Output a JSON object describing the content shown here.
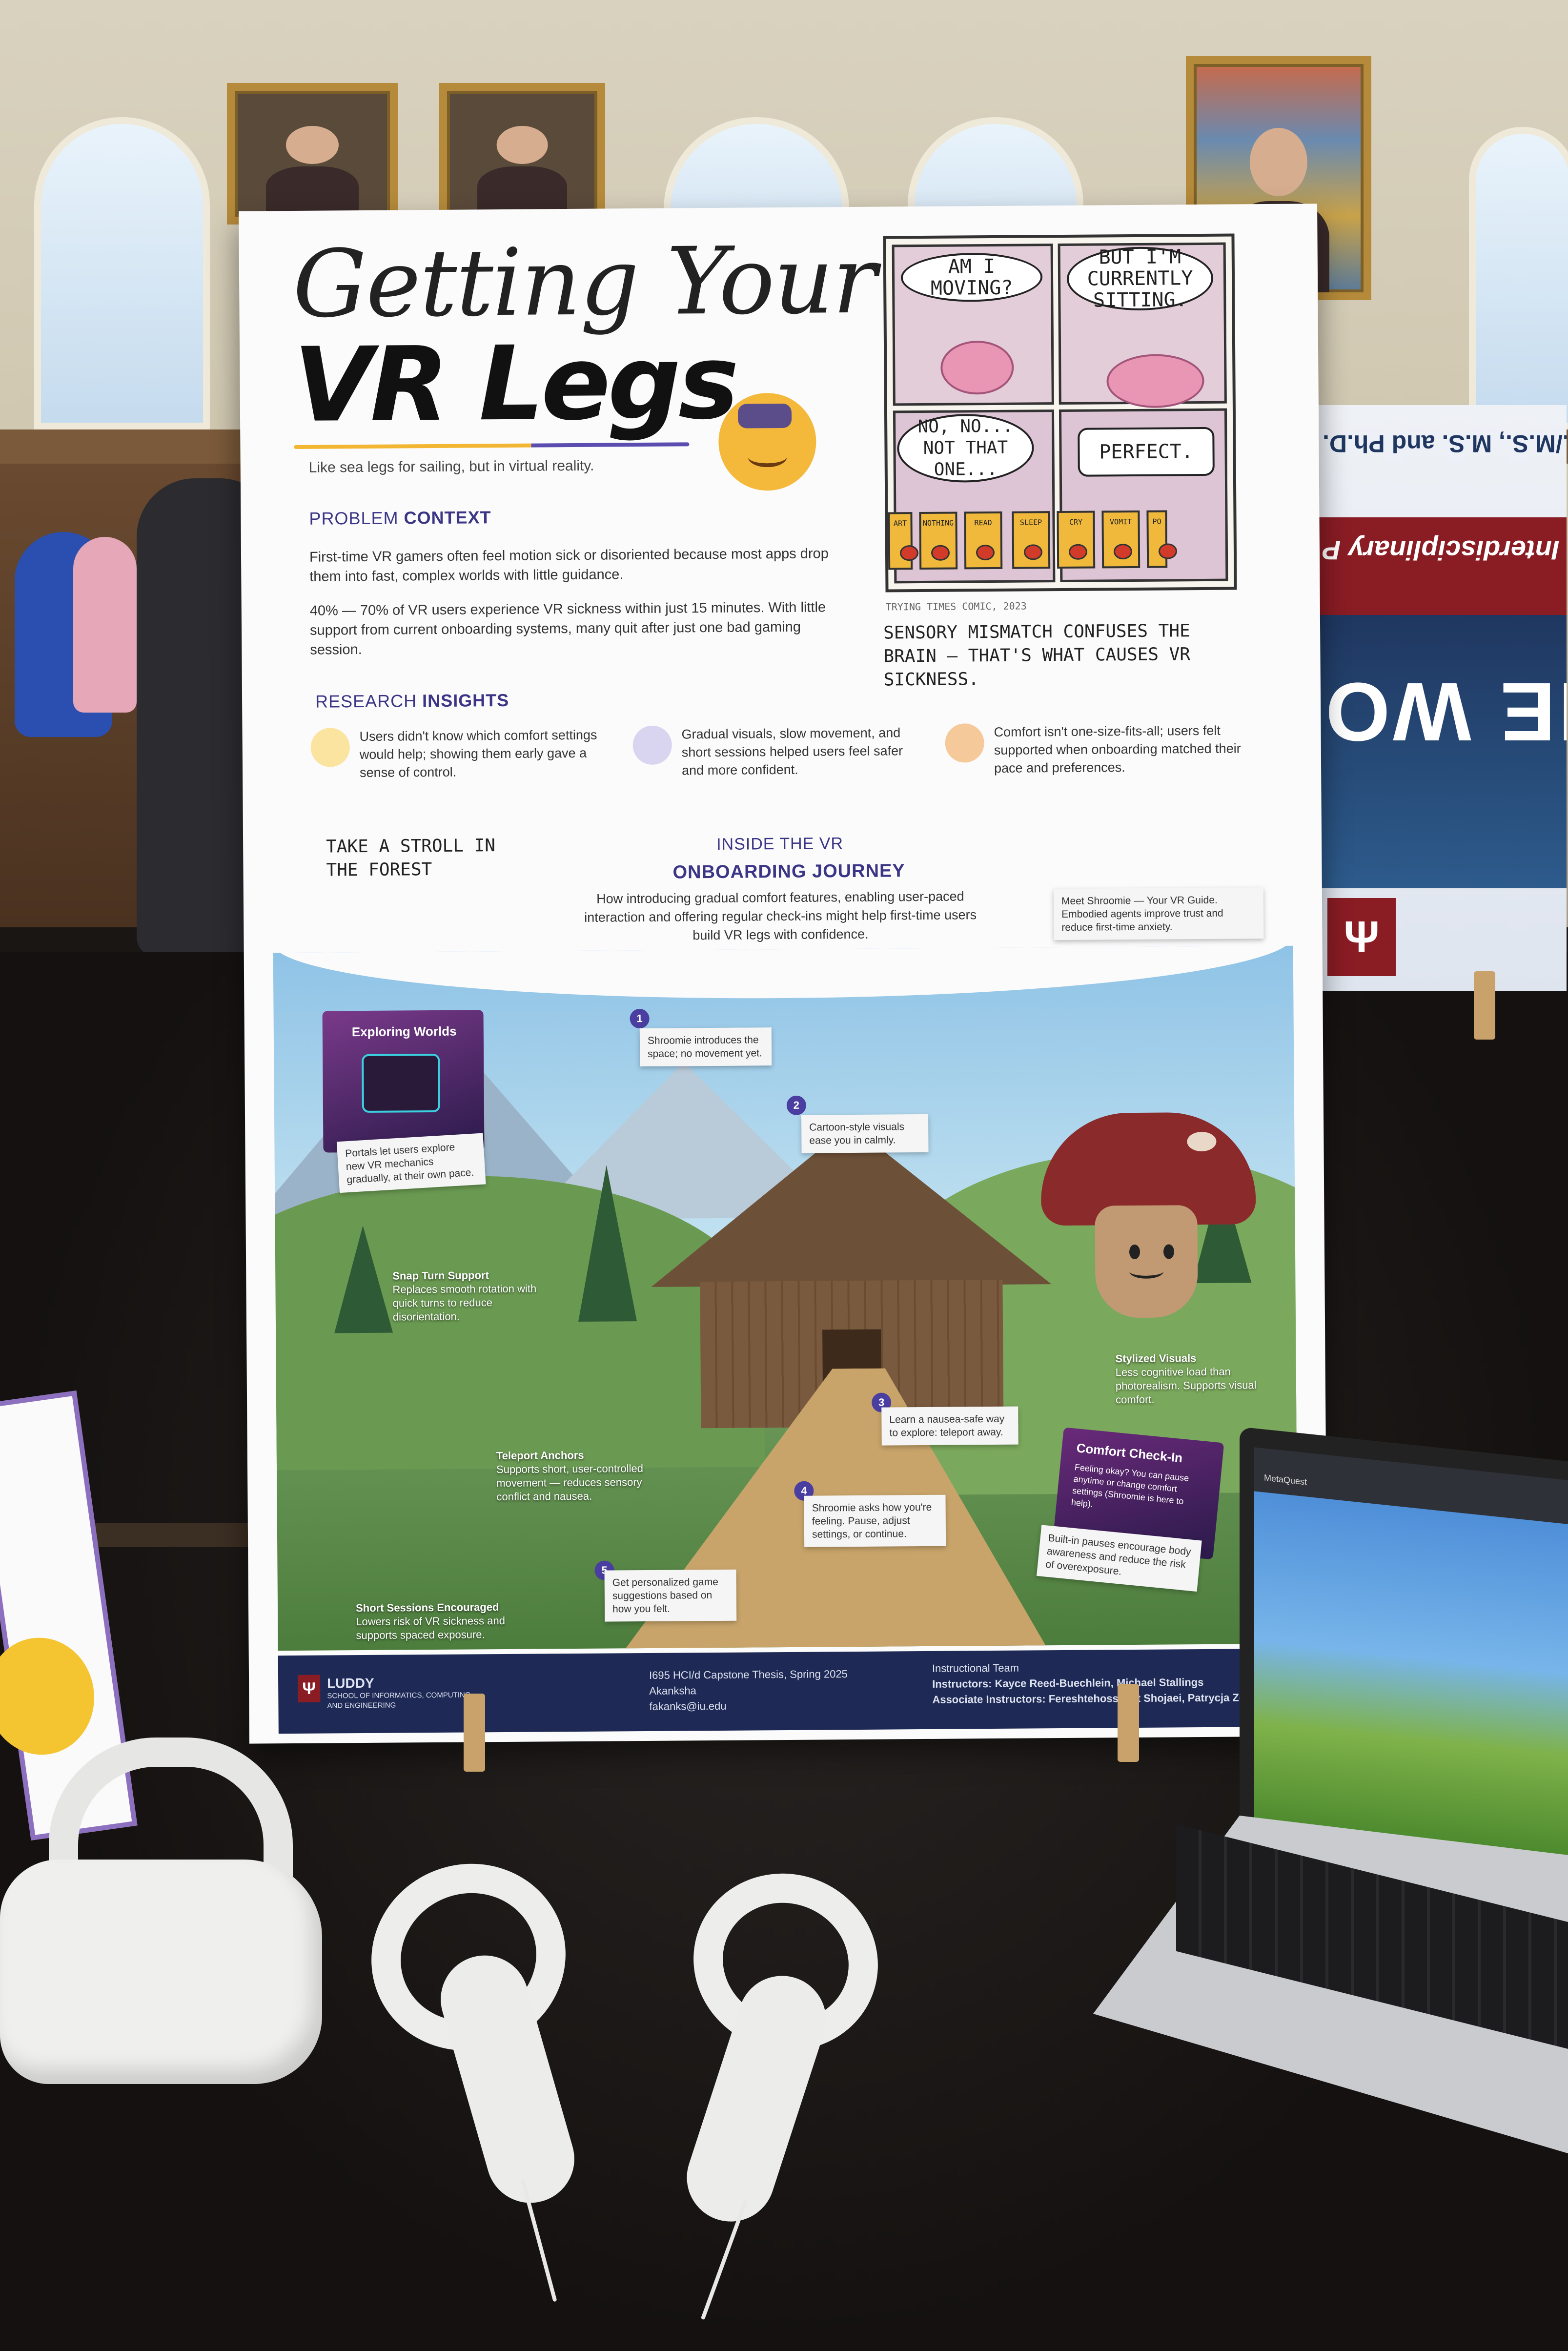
{
  "poster": {
    "title_line1": "Getting Your",
    "title_line2": "VR Legs",
    "tagline": "Like sea legs for sailing, but in virtual reality.",
    "problem_heading_a": "PROBLEM ",
    "problem_heading_b": "CONTEXT",
    "problem_p1": "First-time VR gamers often feel motion sick or disoriented because most apps drop them into fast, complex worlds with little guidance.",
    "problem_p2": "40% — 70% of VR users experience VR sickness within just 15 minutes. With little support from current onboarding systems, many quit after just one bad gaming session.",
    "research_heading_a": "RESEARCH ",
    "research_heading_b": "INSIGHTS",
    "insights": [
      {
        "text": "Users didn't know which comfort settings would help; showing them early gave a sense of control.",
        "icon": "tulip-icon",
        "color": "#f2b632"
      },
      {
        "text": "Gradual visuals, slow movement, and short sessions helped users feel safer and more confident.",
        "icon": "hourglass-icon",
        "color": "#5b4db0"
      },
      {
        "text": "Comfort isn't one-size-fits-all; users felt supported when onboarding matched their pace and preferences.",
        "icon": "hand-heart-icon",
        "color": "#e08a3a"
      }
    ],
    "comic": {
      "bubble1": "AM I MOVING?",
      "bubble2": "BUT I'M CURRENTLY SITTING.",
      "bubble3": "NO, NO... NOT THAT ONE...",
      "bubble4": "PERFECT.",
      "buttons": [
        "ART",
        "NOTHING",
        "READ",
        "SLEEP",
        "CRY",
        "VOMIT",
        "PO"
      ],
      "credit": "TRYING TIMES COMIC, 2023",
      "caption": "SENSORY MISMATCH CONFUSES THE BRAIN — THAT'S WHAT CAUSES VR SICKNESS."
    },
    "stroll": "TAKE A STROLL IN THE FOREST",
    "journey_heading_a": "INSIDE THE VR",
    "journey_heading_b": "ONBOARDING JOURNEY",
    "journey_desc": "How introducing gradual comfort features, enabling user-paced interaction and offering regular check-ins might help first-time users build VR legs with confidence.",
    "meet": "Meet Shroomie — Your VR Guide. Embodied agents improve trust and reduce first-time anxiety.",
    "exploring_title": "Exploring Worlds",
    "exploring_note": "Portals let users explore new VR mechanics gradually, at their own pace.",
    "steps": [
      {
        "num": "1",
        "text": "Shroomie introduces the space; no movement yet."
      },
      {
        "num": "2",
        "text": "Cartoon-style visuals ease you in calmly."
      },
      {
        "num": "3",
        "text": "Learn a nausea-safe way to explore: teleport away."
      },
      {
        "num": "4",
        "text": "Shroomie asks how you're feeling. Pause, adjust settings, or continue."
      },
      {
        "num": "5",
        "text": "Get personalized game suggestions based on how you felt."
      }
    ],
    "snap_title": "Snap Turn Support",
    "snap_text": "Replaces smooth rotation with quick turns to reduce disorientation.",
    "teleport_title": "Teleport Anchors",
    "teleport_text": "Supports short, user-controlled movement — reduces sensory conflict and nausea.",
    "sessions_title": "Short Sessions Encouraged",
    "sessions_text": "Lowers risk of VR sickness and supports spaced exposure.",
    "stylized_title": "Stylized Visuals",
    "stylized_text": "Less cognitive load than photorealism. Supports visual comfort.",
    "checkin_title": "Comfort Check-In",
    "checkin_text": "Feeling okay? You can pause anytime or change comfort settings (Shroomie is here to help).",
    "checkin_note": "Built-in pauses encourage body awareness and reduce the risk of overexposure.",
    "footer": {
      "school": "LUDDY",
      "school_sub": "SCHOOL OF INFORMATICS, COMPUTING, AND ENGINEERING",
      "course": "I695 HCI/d Capstone Thesis, Spring 2025",
      "author": "Akanksha",
      "email": "fakanks@iu.edu",
      "team_heading": "Instructional Team",
      "instructors": "Instructors: Kayce Reed-Buechlein, Michael Stallings",
      "associates": "Associate Instructors: Fereshtehossadat Shojaei, Patrycja Zdziarska"
    }
  },
  "banner": {
    "line1": "Accelerated B.S./M.S., M.S. and Ph.D.",
    "line2": "Explore Luddy's Interdisciplinary P",
    "line3": "CHANGE THE WO",
    "logo": "Ψ"
  },
  "laptop": {
    "tab": "MetaQuest"
  }
}
